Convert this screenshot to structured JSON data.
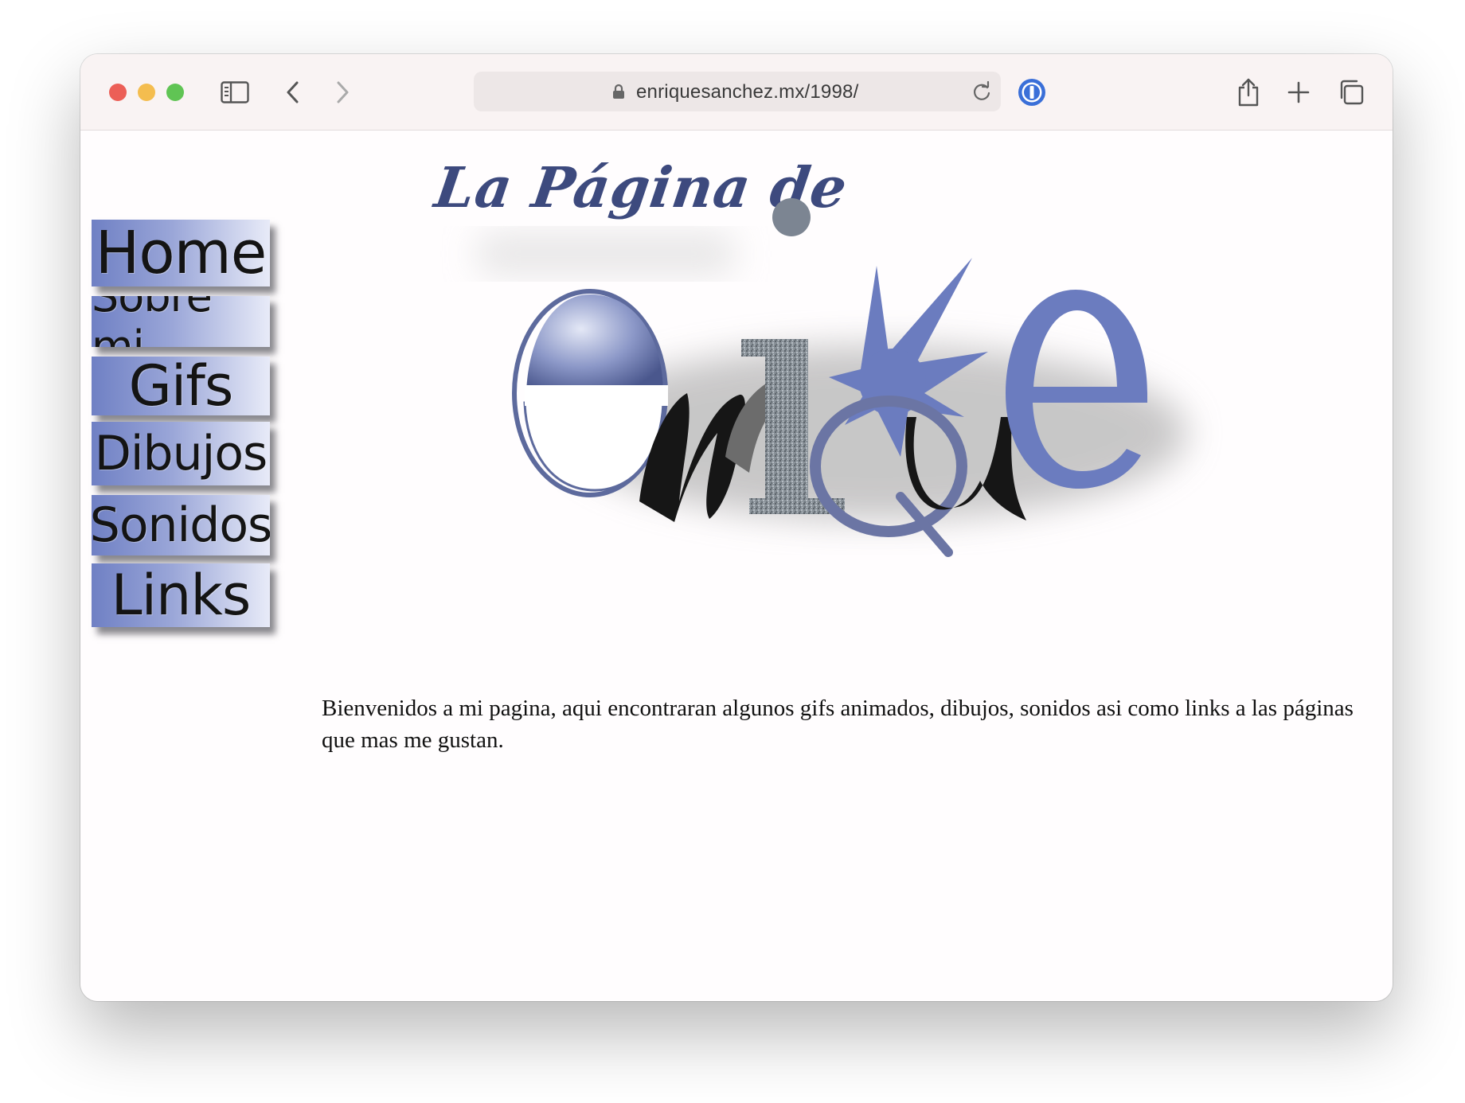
{
  "browser": {
    "url": "enriquesanchez.mx/1998/",
    "password_manager_label": "1"
  },
  "nav": {
    "items": [
      {
        "label": "Home"
      },
      {
        "label": "Sobre mi"
      },
      {
        "label": "Gifs"
      },
      {
        "label": "Dibujos"
      },
      {
        "label": "Sonidos"
      },
      {
        "label": "Links"
      }
    ]
  },
  "logo": {
    "title": "La Página de",
    "name": "enrique"
  },
  "welcome": {
    "text": "Bienvenidos a mi pagina, aqui encontraran algunos gifs animados, dibujos, sonidos  asi como links a las páginas que mas me gustan."
  },
  "colors": {
    "accent_blue": "#6b7cbf",
    "dark_navy": "#3d4a7e",
    "toolbar_bg": "#f9f3f3"
  }
}
